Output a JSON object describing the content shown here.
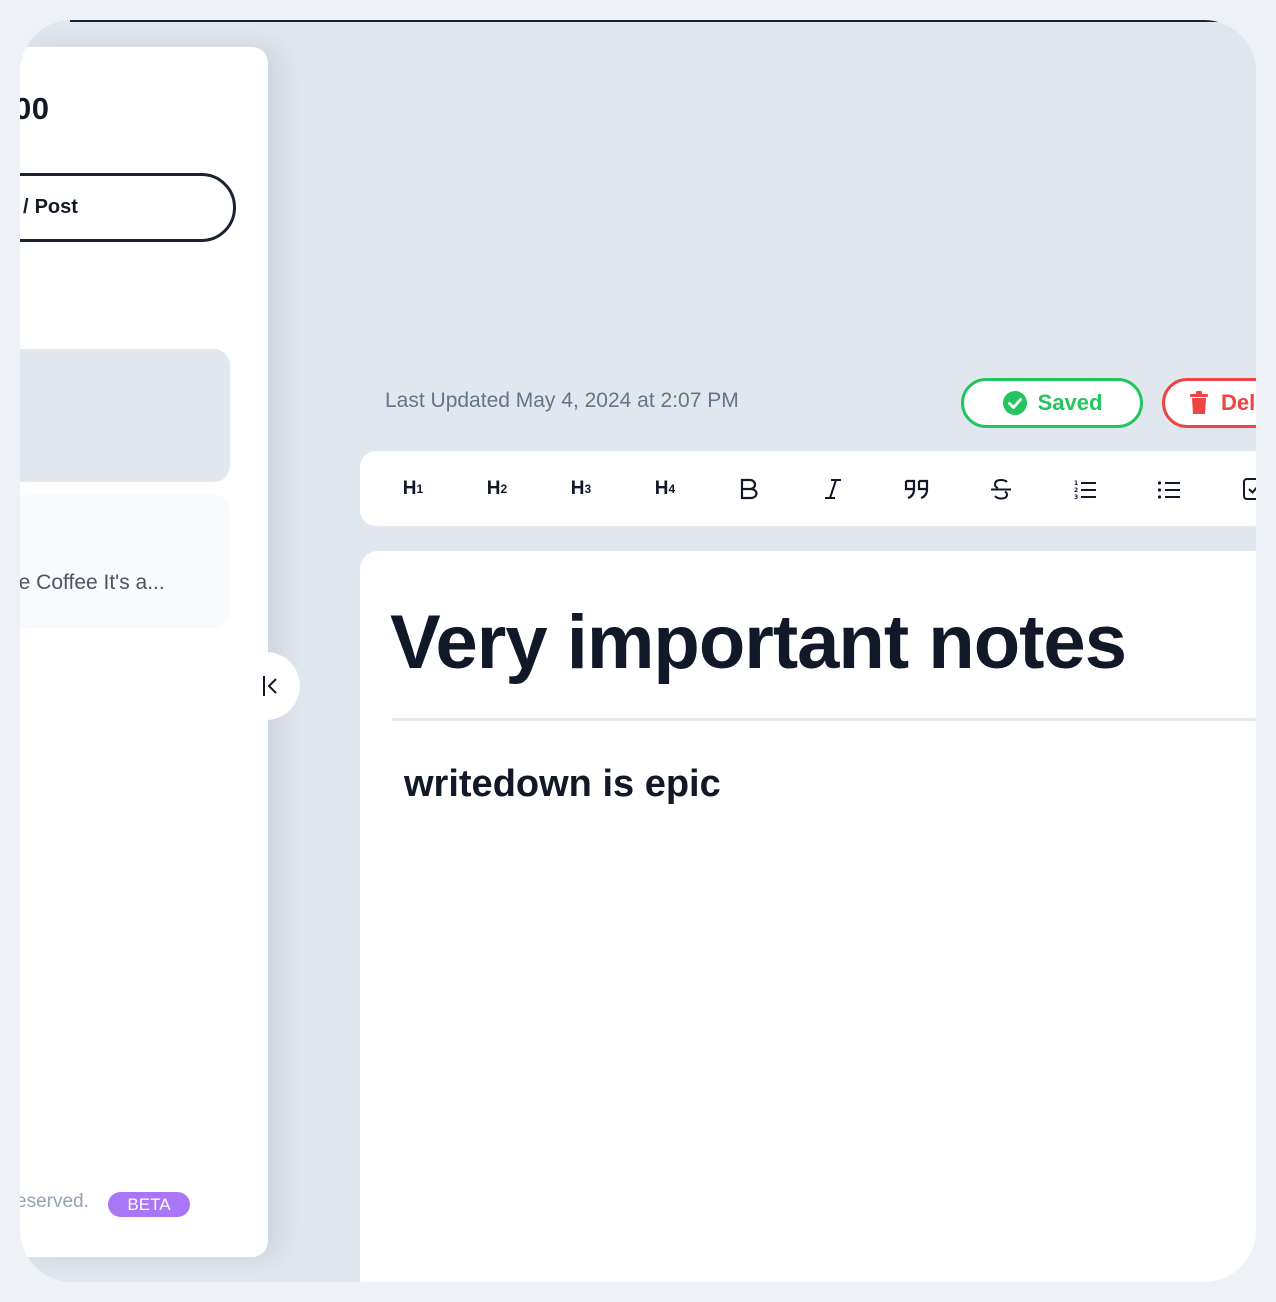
{
  "sidebar": {
    "brand": "00",
    "new_post_label": "Post",
    "posts": [
      {
        "excerpt": "ore Coffee It's a..."
      }
    ],
    "footer_text": "eserved.",
    "beta_label": "BETA",
    "collapse_icon": "collapse-left-icon"
  },
  "editor": {
    "last_updated": "Last Updated May 4, 2024 at 2:07 PM",
    "saved_label": "Saved",
    "delete_label": "Del",
    "title": "Very important notes",
    "body": "writedown is epic"
  },
  "toolbar": {
    "items": [
      {
        "name": "heading-1",
        "label": "H",
        "sub": "1"
      },
      {
        "name": "heading-2",
        "label": "H",
        "sub": "2"
      },
      {
        "name": "heading-3",
        "label": "H",
        "sub": "3"
      },
      {
        "name": "heading-4",
        "label": "H",
        "sub": "4"
      },
      {
        "name": "bold",
        "icon": "bold-icon"
      },
      {
        "name": "italic",
        "icon": "italic-icon"
      },
      {
        "name": "quote",
        "icon": "quote-icon"
      },
      {
        "name": "strikethrough",
        "icon": "strikethrough-icon"
      },
      {
        "name": "ordered-list",
        "icon": "ordered-list-icon"
      },
      {
        "name": "bullet-list",
        "icon": "bullet-list-icon"
      },
      {
        "name": "task-list",
        "icon": "checkbox-icon"
      }
    ]
  },
  "colors": {
    "success": "#22c55e",
    "danger": "#ef4444",
    "beta": "#a977f6",
    "text": "#111827"
  }
}
